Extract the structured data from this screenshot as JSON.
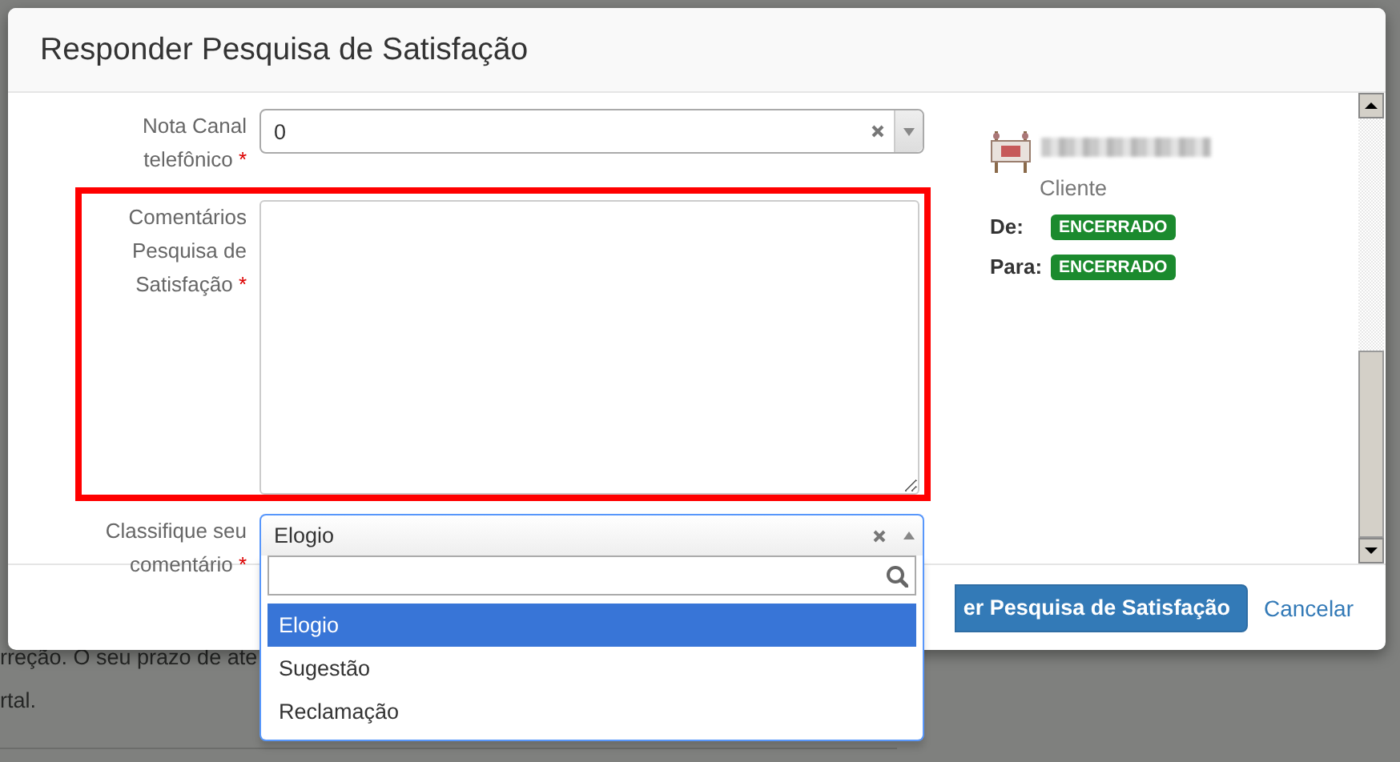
{
  "background_page": {
    "lines": [
      "rreção. O seu prazo de ate",
      "rtal."
    ]
  },
  "dialog": {
    "title": "Responder Pesquisa de Satisfação",
    "fields": [
      {
        "kind": "select",
        "label": "Nota Canal telefônico",
        "required_mark": "*",
        "value": "0",
        "open": false,
        "highlighted": false
      },
      {
        "kind": "textarea",
        "label": "Comentários Pesquisa de Satisfação",
        "required_mark": "*",
        "highlighted": true
      },
      {
        "kind": "select",
        "label": "Classifique seu comentário",
        "required_mark": "*",
        "value": "Elogio",
        "open": true,
        "highlighted": false,
        "options": [
          {
            "label": "Elogio",
            "selected": true
          },
          {
            "label": "Sugestão",
            "selected": false
          },
          {
            "label": "Reclamação",
            "selected": false
          }
        ]
      }
    ],
    "contact": {
      "role": "Cliente",
      "statuses": [
        {
          "label": "De:",
          "status": "ENCERRADO",
          "color": "#1b8a2e"
        },
        {
          "label": "Para:",
          "status": "ENCERRADO",
          "color": "#1b8a2e"
        }
      ]
    },
    "buttons": {
      "submit": "er Pesquisa de Satisfação",
      "cancel": "Cancelar"
    }
  }
}
